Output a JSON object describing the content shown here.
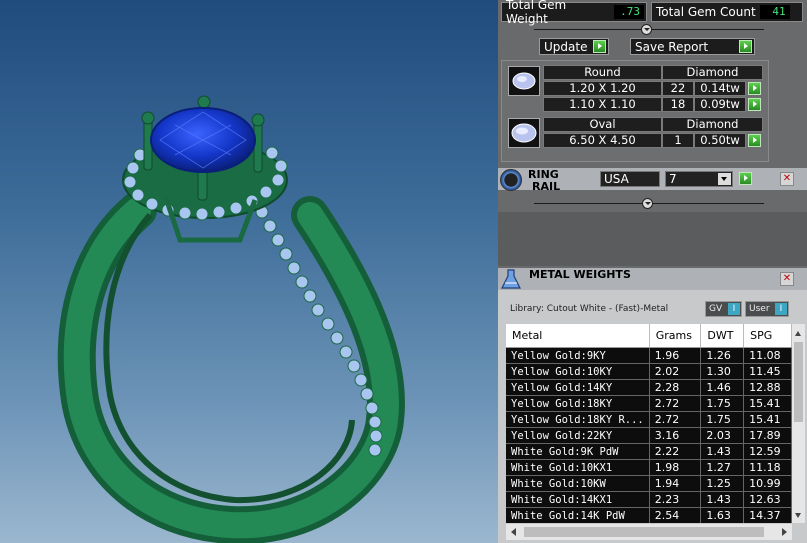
{
  "stats": {
    "gem_weight_label": "Total Gem Weight",
    "gem_weight_value": ".73",
    "gem_count_label": "Total Gem Count",
    "gem_count_value": "41"
  },
  "actions": {
    "update_label": "Update",
    "save_label": "Save Report"
  },
  "gems": {
    "round": {
      "shape": "Round",
      "material": "Diamond",
      "rows": [
        {
          "size": "1.20 X 1.20",
          "count": "22",
          "weight": "0.14tw"
        },
        {
          "size": "1.10 X 1.10",
          "count": "18",
          "weight": "0.09tw"
        }
      ]
    },
    "oval": {
      "shape": "Oval",
      "material": "Diamond",
      "rows": [
        {
          "size": "6.50 X 4.50",
          "count": "1",
          "weight": "0.50tw"
        }
      ]
    }
  },
  "ring_rail": {
    "title_line1": "RING",
    "title_line2": "RAIL",
    "standard": "USA",
    "size": "7"
  },
  "metal_weights": {
    "title": "METAL WEIGHTS",
    "library": "Library: Cutout White - (Fast)-Metal",
    "toggle_gv": "GV",
    "toggle_user": "User",
    "toggle_mark": "I",
    "columns": [
      "Metal",
      "Grams",
      "DWT",
      "SPG"
    ],
    "rows": [
      [
        "Yellow Gold:9KY",
        "1.96",
        "1.26",
        "11.08"
      ],
      [
        "Yellow Gold:10KY",
        "2.02",
        "1.30",
        "11.45"
      ],
      [
        "Yellow Gold:14KY",
        "2.28",
        "1.46",
        "12.88"
      ],
      [
        "Yellow Gold:18KY",
        "2.72",
        "1.75",
        "15.41"
      ],
      [
        "Yellow Gold:18KY R...",
        "2.72",
        "1.75",
        "15.41"
      ],
      [
        "Yellow Gold:22KY",
        "3.16",
        "2.03",
        "17.89"
      ],
      [
        "White Gold:9K PdW",
        "2.22",
        "1.43",
        "12.59"
      ],
      [
        "White Gold:10KX1",
        "1.98",
        "1.27",
        "11.18"
      ],
      [
        "White Gold:10KW",
        "1.94",
        "1.25",
        "10.99"
      ],
      [
        "White Gold:14KX1",
        "2.23",
        "1.43",
        "12.63"
      ],
      [
        "White Gold:14K PdW",
        "2.54",
        "1.63",
        "14.37"
      ]
    ]
  },
  "colors": {
    "ring_metal": "#1f7a4d",
    "center_stone": "#1436c8",
    "melee": "#a9c6f0",
    "readout_green": "#45e37a"
  }
}
